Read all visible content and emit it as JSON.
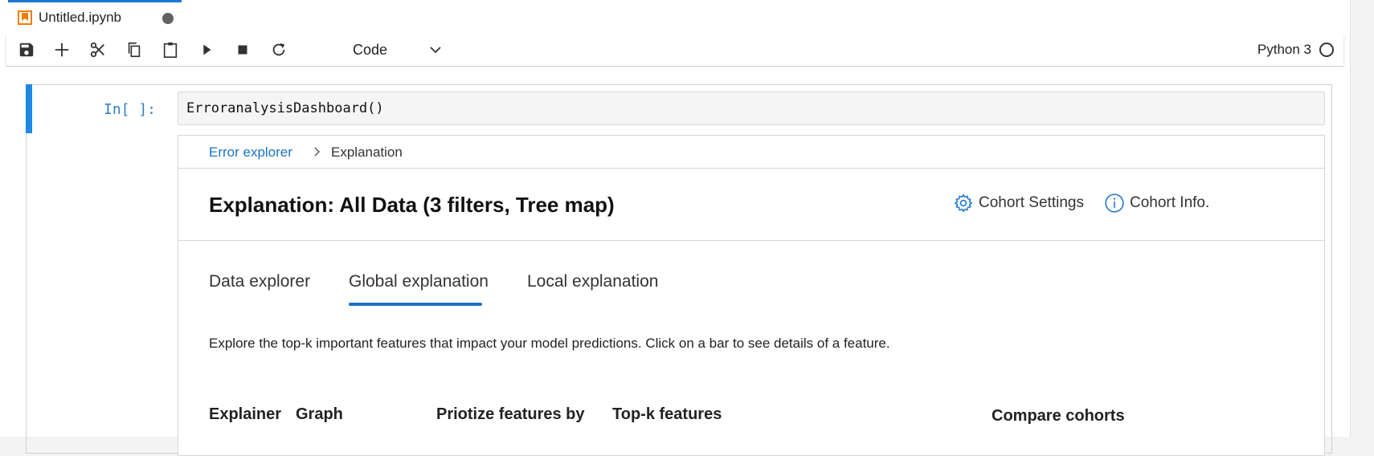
{
  "tab": {
    "title": "Untitled.ipynb",
    "icon": "notebook-icon",
    "unsaved": true
  },
  "toolbar": {
    "buttons": [
      "save-icon",
      "add-icon",
      "cut-icon",
      "copy-icon",
      "paste-icon",
      "run-icon",
      "stop-icon",
      "restart-icon"
    ],
    "cell_type": "Code",
    "kernel_name": "Python 3",
    "kernel_status": "idle"
  },
  "cell": {
    "prompt": "In[ ]:",
    "code": "ErroranalysisDashboard()"
  },
  "widget": {
    "breadcrumb": {
      "link": "Error explorer",
      "separator": ">",
      "current": "Explanation"
    },
    "title": "Explanation: All Data (3 filters, Tree map)",
    "cohort_settings": "Cohort Settings",
    "cohort_info": "Cohort Info.",
    "tabs": [
      {
        "label": "Data explorer",
        "active": false
      },
      {
        "label": "Global explanation",
        "active": true
      },
      {
        "label": "Local explanation",
        "active": false
      }
    ],
    "description": "Explore the top-k important features that impact your model predictions. Click on a bar to see details of a feature.",
    "controls": {
      "explainer": "Explainer",
      "graph": "Graph",
      "prioritize": "Priotize features by",
      "topk": "Top-k features",
      "compare": "Compare cohorts"
    }
  },
  "colors": {
    "accent": "#1a73c8",
    "active_cell": "#1e88e5",
    "notebook_icon": "#f57c00"
  }
}
